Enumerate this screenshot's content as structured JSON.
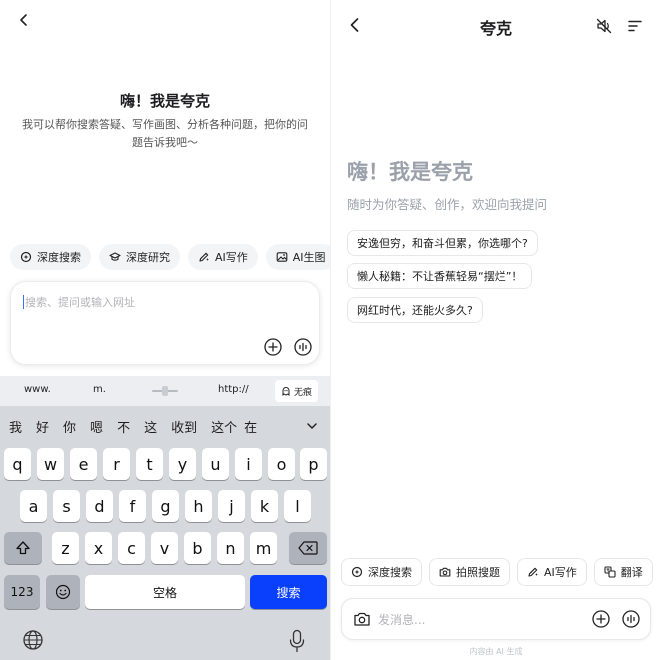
{
  "left": {
    "greeting": {
      "title": "嗨！我是夸克",
      "subtitle": "我可以帮你搜索答疑、写作画图、分析各种问题，把你的问题告诉我吧～"
    },
    "chips": [
      {
        "label": "深度搜索",
        "icon": "sparkle-search-icon"
      },
      {
        "label": "深度研究",
        "icon": "graduation-cap-icon"
      },
      {
        "label": "AI写作",
        "icon": "pen-sparkle-icon"
      },
      {
        "label": "AI生图",
        "icon": "image-icon"
      }
    ],
    "search": {
      "placeholder": "搜索、提问或输入网址"
    },
    "keyboard": {
      "shortcuts": [
        "www.",
        "m.",
        "http://"
      ],
      "incognito_label": "无痕",
      "candidates": [
        "我",
        "好",
        "你",
        "嗯",
        "不",
        "这",
        "收到",
        "这个",
        "在"
      ],
      "row1": [
        "q",
        "w",
        "e",
        "r",
        "t",
        "y",
        "u",
        "i",
        "o",
        "p"
      ],
      "row2": [
        "a",
        "s",
        "d",
        "f",
        "g",
        "h",
        "j",
        "k",
        "l"
      ],
      "row3": [
        "z",
        "x",
        "c",
        "v",
        "b",
        "n",
        "m"
      ],
      "num_label": "123",
      "space_label": "空格",
      "search_label": "搜索"
    }
  },
  "right": {
    "title": "夸克",
    "greeting": "嗨！我是夸克",
    "subtitle": "随时为你答疑、创作，欢迎向我提问",
    "suggestions": [
      "安逸但穷，和奋斗但累，你选哪个?",
      "懒人秘籍：不让香蕉轻易“摆烂”！",
      "网红时代，还能火多久?"
    ],
    "chips": [
      {
        "label": "深度搜索",
        "icon": "sparkle-search-icon"
      },
      {
        "label": "拍照搜题",
        "icon": "camera-icon"
      },
      {
        "label": "AI写作",
        "icon": "pen-sparkle-icon"
      },
      {
        "label": "翻译",
        "icon": "translate-icon"
      }
    ],
    "input": {
      "placeholder": "发消息..."
    },
    "footer": "内容由 AI 生成"
  }
}
